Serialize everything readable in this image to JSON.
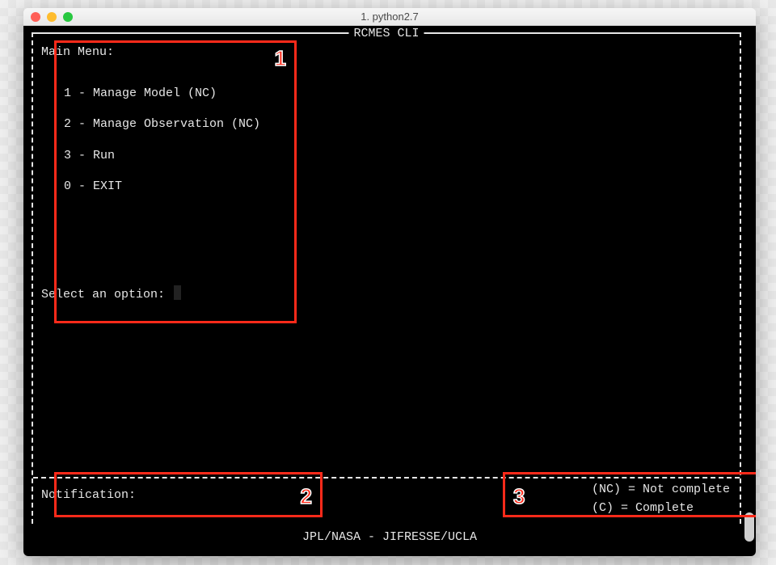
{
  "window": {
    "title": "1. python2.7"
  },
  "app": {
    "title": "RCMES CLI",
    "footer": "JPL/NASA - JIFRESSE/UCLA"
  },
  "menu": {
    "heading": "Main Menu:",
    "items": [
      "1 - Manage Model (NC)",
      "2 - Manage Observation (NC)",
      "3 - Run",
      "0 - EXIT"
    ],
    "prompt": "Select an option:",
    "input_value": ""
  },
  "notification": {
    "label": "Notification:",
    "message": ""
  },
  "legend": {
    "line1": "(NC) = Not complete",
    "line2": "(C)  = Complete"
  },
  "annotations": {
    "1": "1",
    "2": "2",
    "3": "3"
  }
}
